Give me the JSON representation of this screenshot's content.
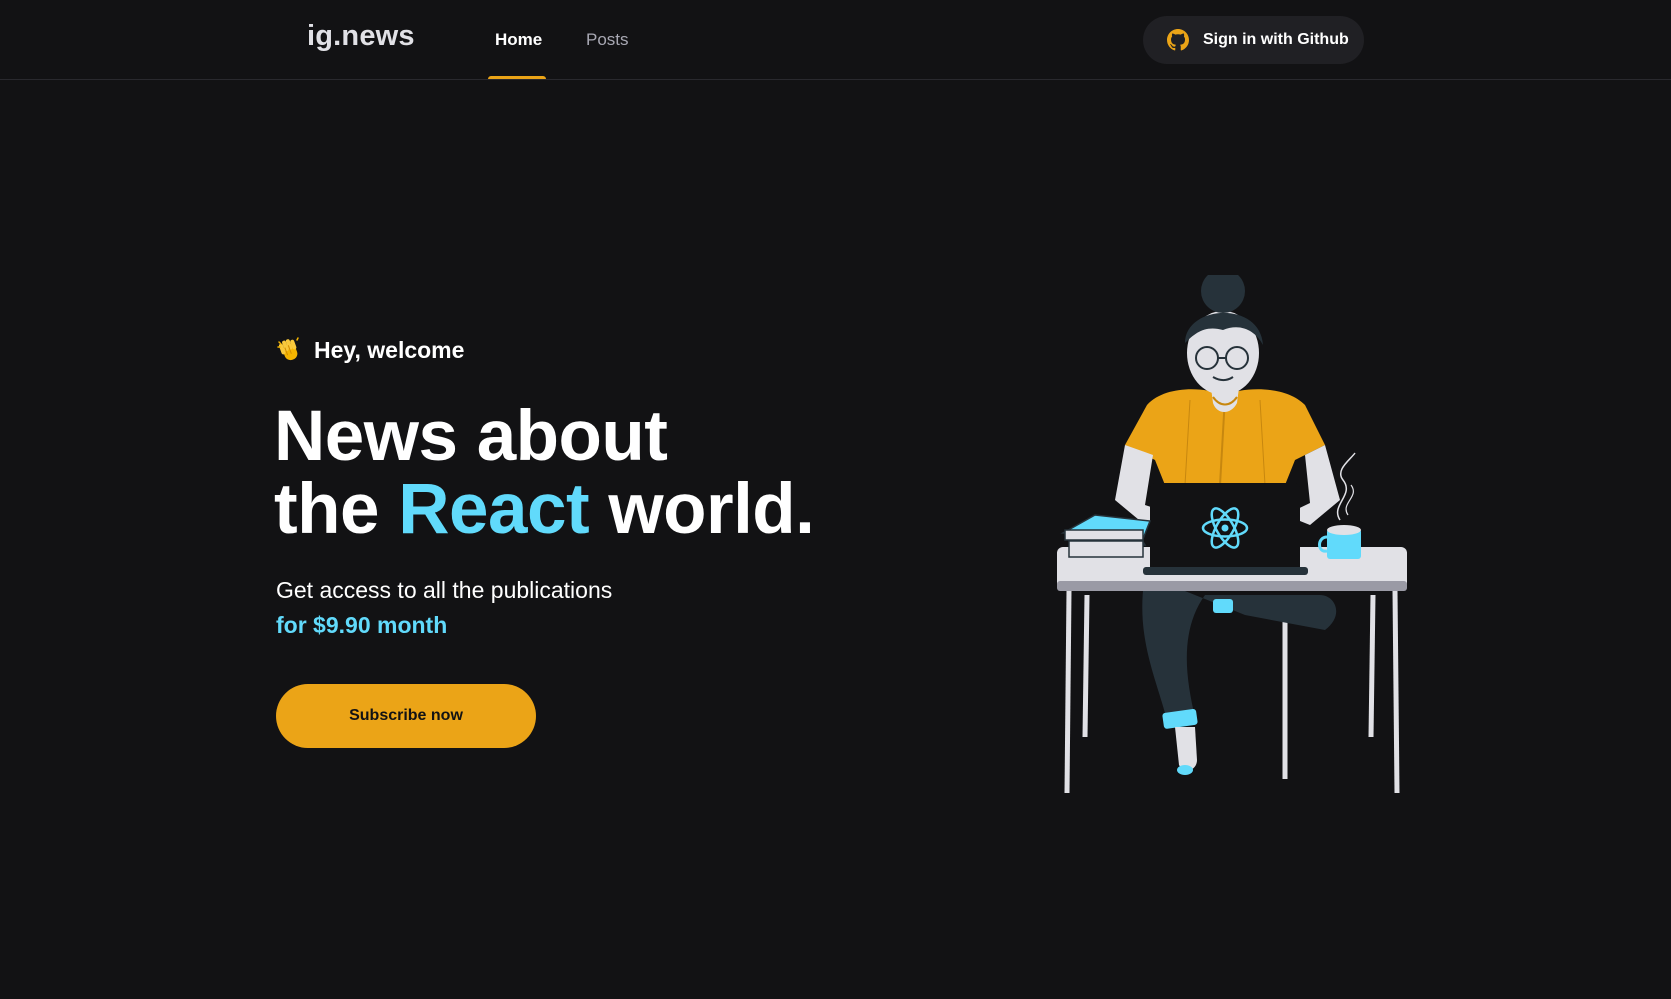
{
  "header": {
    "logo": "ig.news",
    "nav": [
      {
        "label": "Home",
        "active": true
      },
      {
        "label": "Posts",
        "active": false
      }
    ],
    "signin_label": "Sign in with Github"
  },
  "hero": {
    "welcome": "Hey, welcome",
    "title_line1": "News about",
    "title_line2_pre": "the ",
    "title_accent": "React",
    "title_line2_post": " world.",
    "subtitle": "Get access to all the publications",
    "price": "for $9.90 month",
    "subscribe_label": "Subscribe now"
  },
  "icons": {
    "signin": "github-icon",
    "welcome": "clapping-hands-icon",
    "illustration": "woman-laptop-illustration"
  },
  "colors": {
    "background": "#121214",
    "accent_yellow": "#eba417",
    "accent_cyan": "#61dafb",
    "button_dark": "#202024"
  }
}
